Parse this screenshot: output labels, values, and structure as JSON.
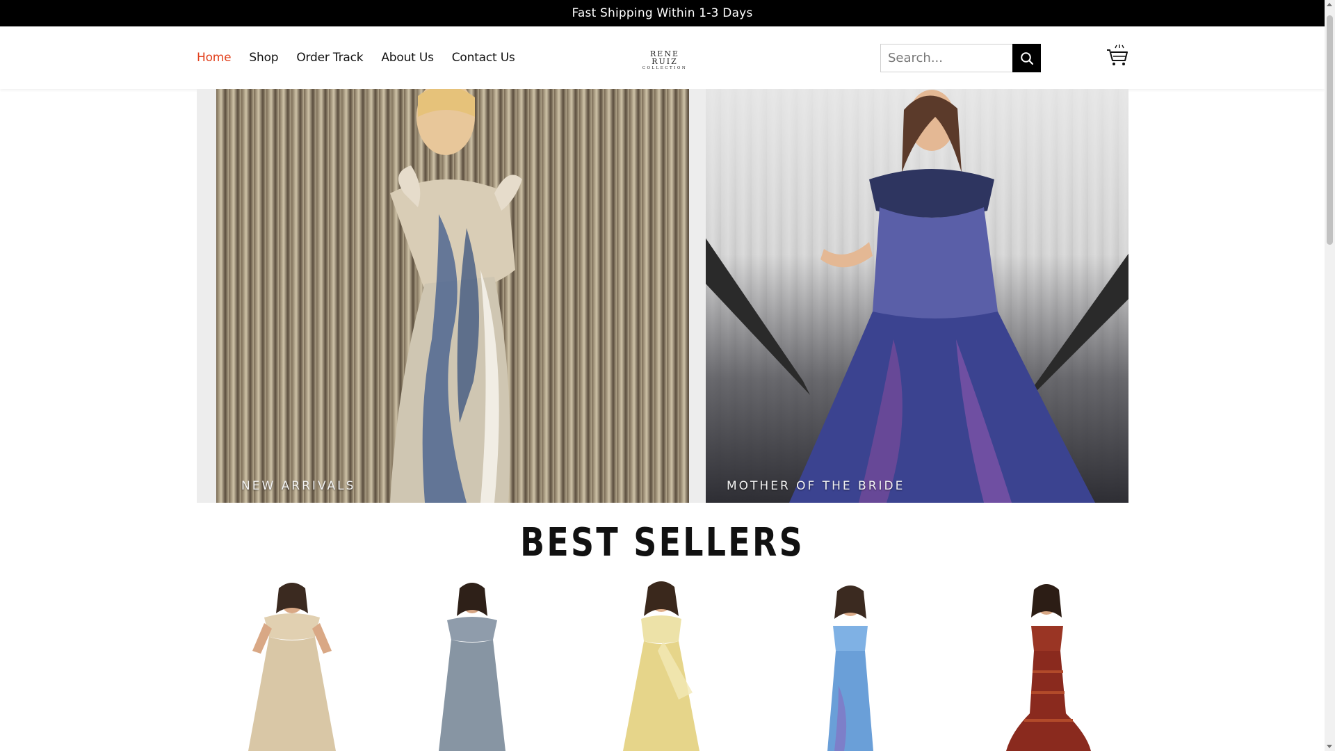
{
  "announcement": {
    "text": "Fast Shipping Within 1-3 Days"
  },
  "nav": {
    "items": [
      {
        "label": "Home",
        "active": true
      },
      {
        "label": "Shop",
        "active": false
      },
      {
        "label": "Order Track",
        "active": false
      },
      {
        "label": "About Us",
        "active": false
      },
      {
        "label": "Contact Us",
        "active": false
      }
    ]
  },
  "logo": {
    "line1": "RENE RUIZ",
    "line2": "COLLECTION"
  },
  "search": {
    "placeholder": "Search...",
    "button_icon": "search-icon"
  },
  "cart": {
    "icon": "cart-icon"
  },
  "banner": {
    "left_label": "NEW ARRIVALS",
    "right_label": "MOTHER OF THE BRIDE"
  },
  "best_sellers": {
    "title": "BEST SELLERS",
    "products": [
      {
        "dress_color": "#d9c7a6"
      },
      {
        "dress_color": "#8795a3"
      },
      {
        "dress_color": "#e6d58a"
      },
      {
        "dress_color": "#6a9fd8"
      },
      {
        "dress_color": "#8a2a1e"
      }
    ]
  },
  "colors": {
    "accent": "#e2401c",
    "topbar": "#000000"
  }
}
